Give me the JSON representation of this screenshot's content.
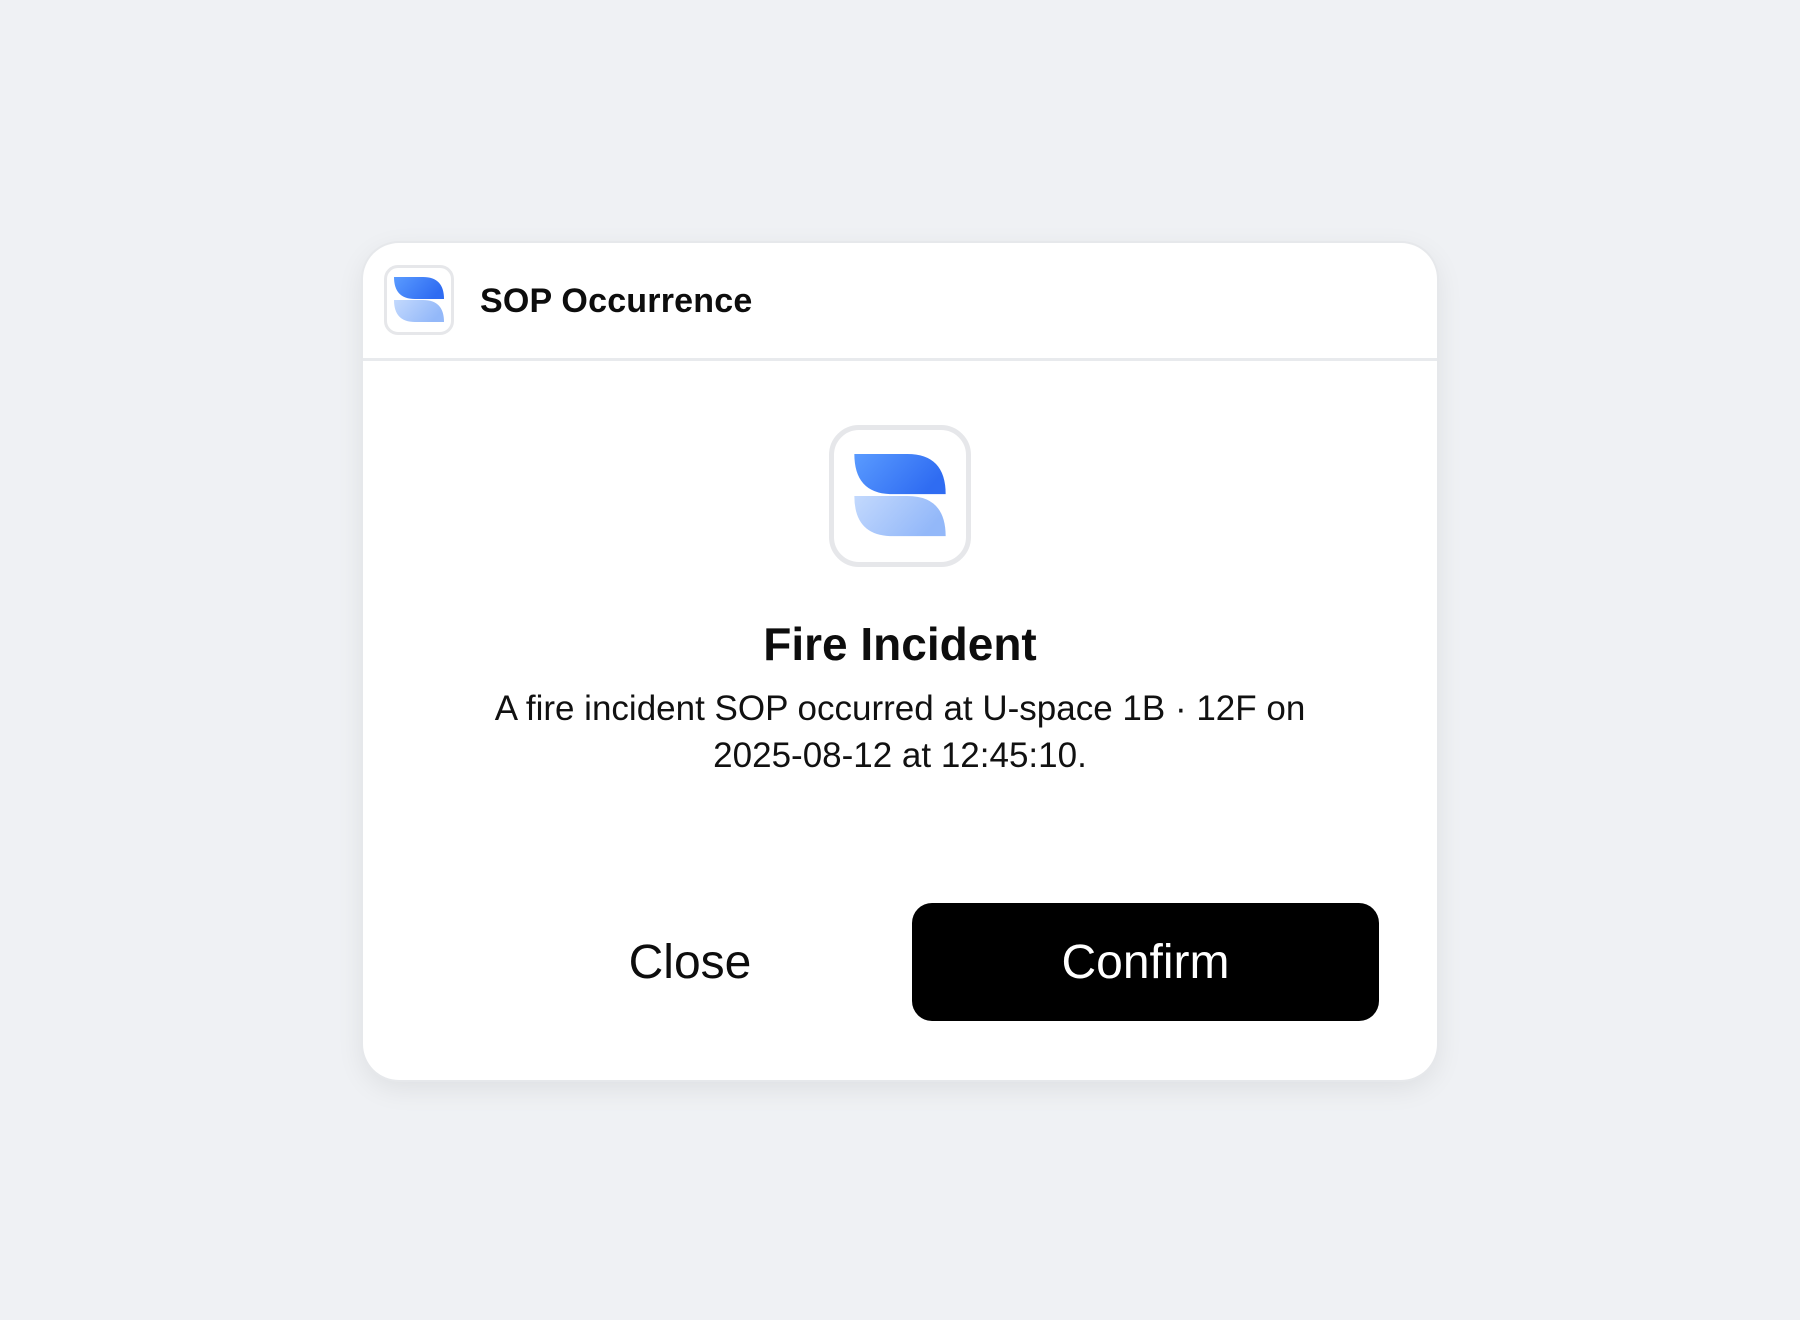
{
  "window": {
    "title": "SOP Occurrence",
    "app_icon": "app-logo-icon",
    "controls": {
      "minimize_icon": "minimize-icon",
      "close_icon": "close-icon"
    }
  },
  "alert": {
    "icon": "app-logo-icon",
    "title": "Fire Incident",
    "message": "A fire incident SOP occurred at U-space 1B · 12F on 2025-08-12 at 12:45:10."
  },
  "actions": {
    "close_label": "Close",
    "confirm_label": "Confirm"
  },
  "colors": {
    "background": "#eff1f4",
    "dialog": "#ffffff",
    "logo_primary": "#3b7df8",
    "logo_secondary": "#a9c8fb",
    "confirm_button": "#000000"
  }
}
